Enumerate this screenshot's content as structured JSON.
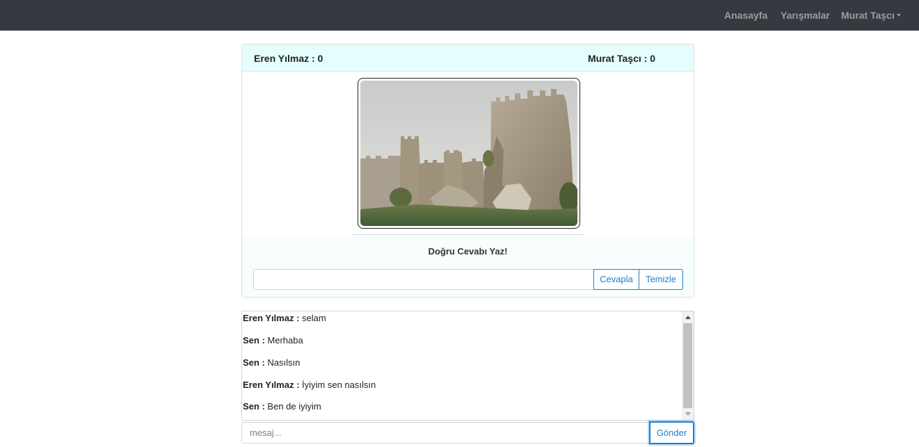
{
  "navbar": {
    "home": "Anasayfa",
    "contests": "Yarışmalar",
    "user": "Murat Taşcı"
  },
  "game": {
    "player1_score": "Eren Yılmaz : 0",
    "player2_score": "Murat Taşcı : 0",
    "prompt": "Doğru Cevabı Yaz!",
    "answer_value": "",
    "answer_button": "Cevapla",
    "clear_button": "Temizle"
  },
  "chat": {
    "messages": [
      {
        "sender": "Eren Yılmaz :",
        "text": "selam"
      },
      {
        "sender": "Sen :",
        "text": "Merhaba"
      },
      {
        "sender": "Sen :",
        "text": "Nasılsın"
      },
      {
        "sender": "Eren Yılmaz :",
        "text": "İyiyim sen nasılsın"
      },
      {
        "sender": "Sen :",
        "text": "Ben de iyiyim"
      }
    ],
    "input_placeholder": "mesaj...",
    "send_button": "Gönder"
  }
}
